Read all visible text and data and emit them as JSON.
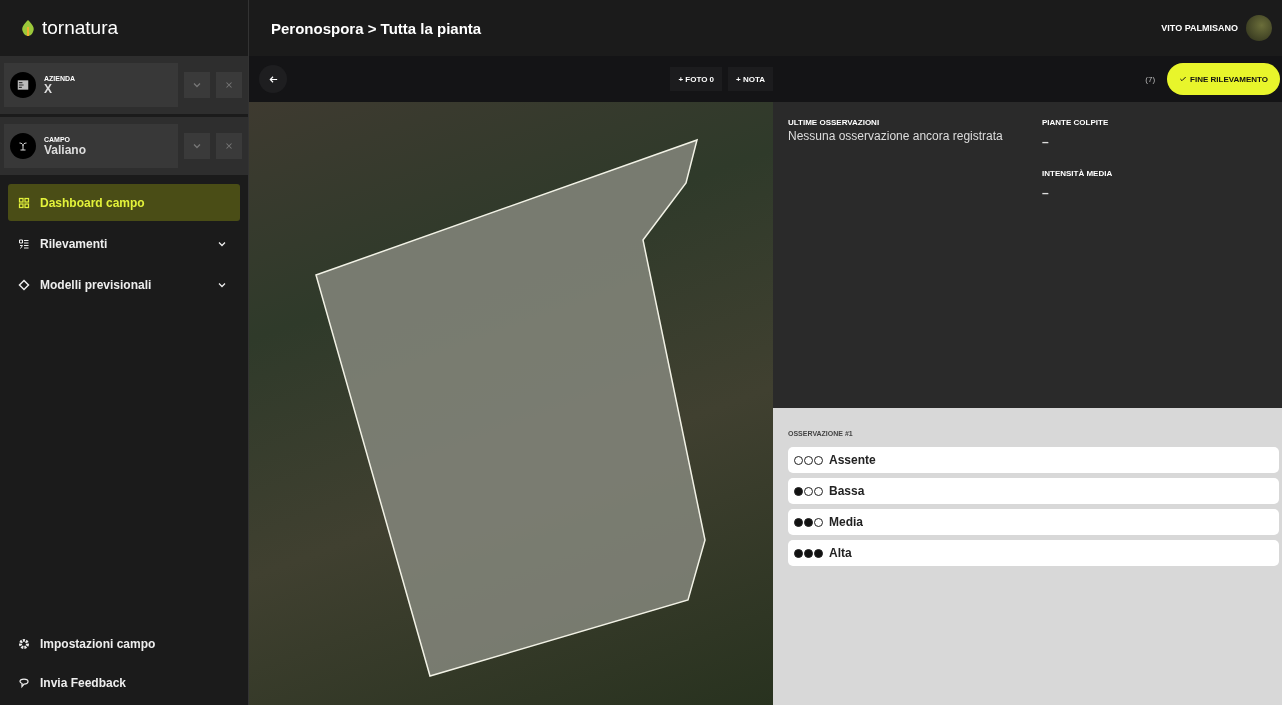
{
  "app": {
    "name": "tornatura"
  },
  "selectors": [
    {
      "label": "AZIENDA",
      "value": "X"
    },
    {
      "label": "CAMPO",
      "value": "Valiano"
    }
  ],
  "nav": [
    {
      "label": "Dashboard campo",
      "kind": "link",
      "selected": true
    },
    {
      "label": "Rilevamenti",
      "kind": "group",
      "selected": false
    },
    {
      "label": "Modelli previsionali",
      "kind": "group",
      "selected": false
    }
  ],
  "footer_nav": [
    {
      "label": "Impostazioni campo",
      "kind": "settings"
    },
    {
      "label": "Invia Feedback",
      "kind": "feedback"
    }
  ],
  "header": {
    "title": "Peronospora > Tutta la pianta",
    "user": "VITO PALMISANO"
  },
  "toolbar": {
    "actions": [
      "+ FOTO 0",
      "+ NOTA"
    ],
    "count": "(7)",
    "finish": "FINE RILEVAMENTO"
  },
  "summary": {
    "last_observations": {
      "label": "ULTIME OSSERVAZIONI",
      "value": "Nessuna osservazione ancora registrata"
    },
    "stats": [
      {
        "label": "PIANTE COLPITE",
        "value": "–"
      },
      {
        "label": "INTENSITÀ MEDIA",
        "value": "–"
      }
    ]
  },
  "observation": {
    "title": "OSSERVAZIONE #1",
    "options": [
      {
        "label": "Assente",
        "stars": 0
      },
      {
        "label": "Bassa",
        "stars": 1
      },
      {
        "label": "Media",
        "stars": 2
      },
      {
        "label": "Alta",
        "stars": 3
      }
    ]
  }
}
